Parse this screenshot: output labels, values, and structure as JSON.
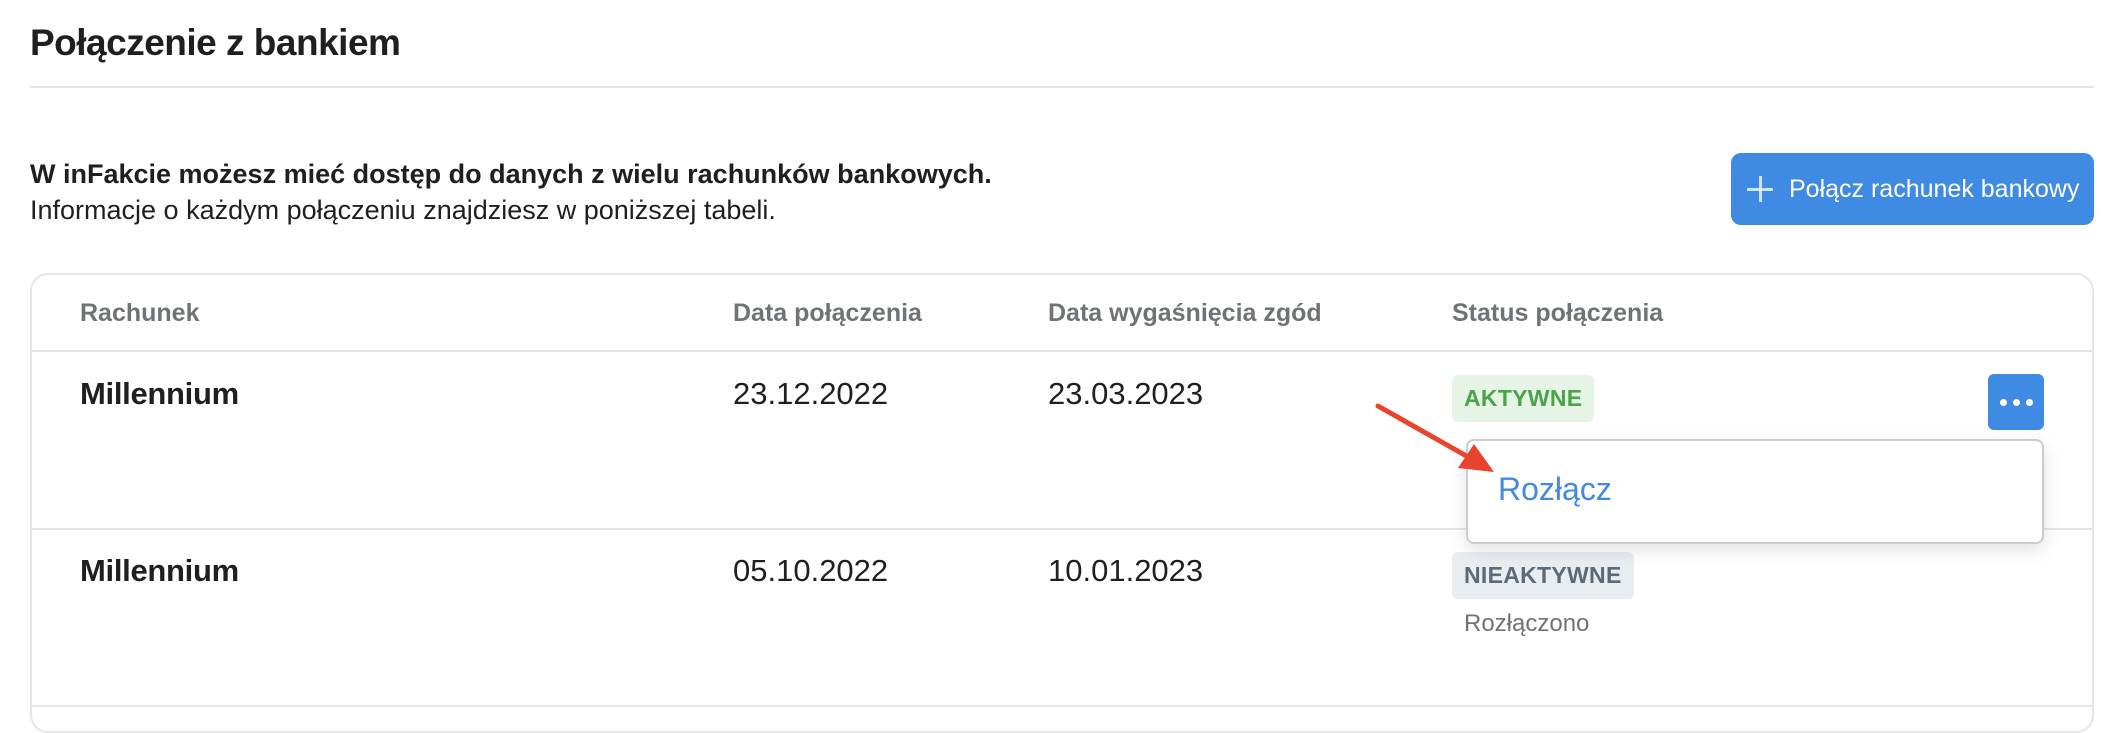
{
  "page": {
    "title": "Połączenie z bankiem",
    "intro_bold": "W inFakcie możesz mieć dostęp do danych z wielu rachunków bankowych.",
    "intro_text": "Informacje o każdym połączeniu znajdziesz w poniższej tabeli."
  },
  "connect_button": {
    "label": "Połącz rachunek bankowy",
    "icon": "plus-icon"
  },
  "table": {
    "headers": [
      "Rachunek",
      "Data połączenia",
      "Data wygaśnięcia zgód",
      "Status połączenia"
    ],
    "rows": [
      {
        "bank": "Millennium",
        "connected": "23.12.2022",
        "expires": "23.03.2023",
        "status": "AKTYWNE",
        "status_note": ""
      },
      {
        "bank": "Millennium",
        "connected": "05.10.2022",
        "expires": "10.01.2023",
        "status": "NIEAKTYWNE",
        "status_note": "Rozłączono"
      }
    ]
  },
  "row_menu": {
    "icon": "more-horizontal-icon",
    "items": [
      "Rozłącz"
    ]
  },
  "colors": {
    "accent": "#3f8ae2",
    "active_badge_bg": "#e6f4e6",
    "active_badge_text": "#4aa34a",
    "inactive_badge_bg": "#eaedf0",
    "inactive_badge_text": "#5b6a78",
    "annotation_arrow": "#e8432e"
  }
}
